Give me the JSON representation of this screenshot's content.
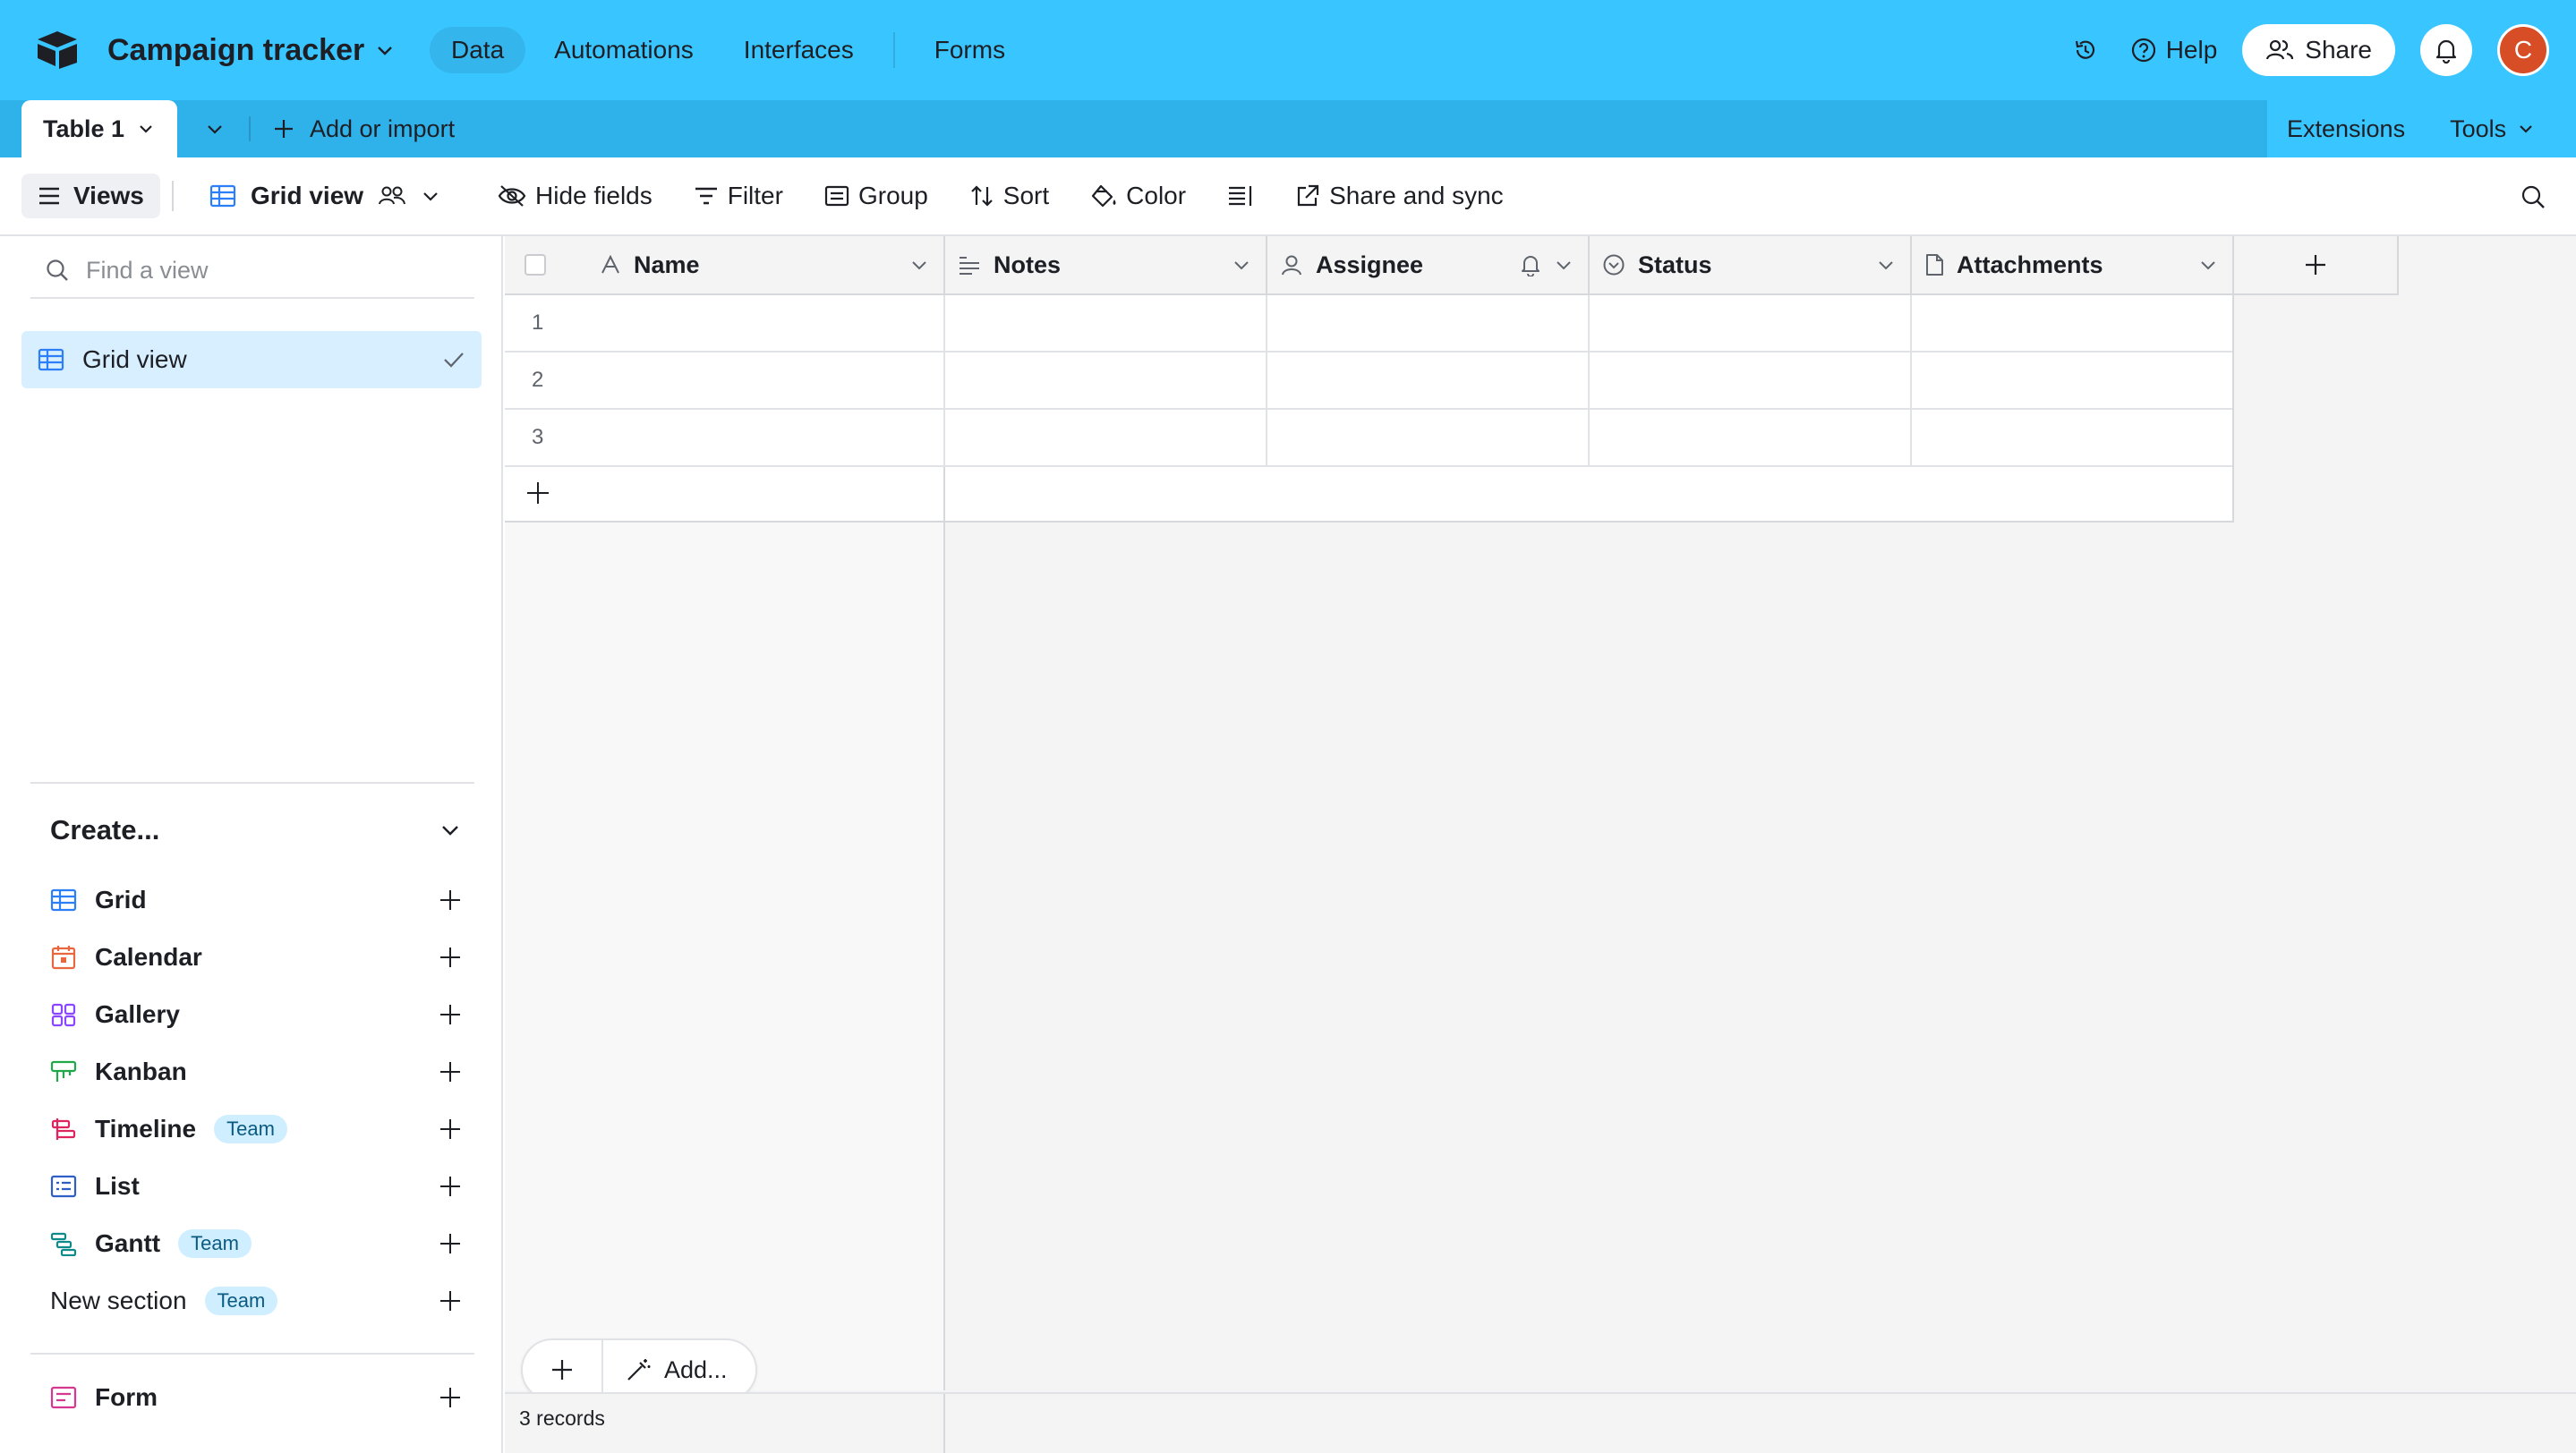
{
  "app": {
    "base_name": "Campaign tracker",
    "nav": [
      "Data",
      "Automations",
      "Interfaces",
      "Forms"
    ],
    "help_label": "Help",
    "share_label": "Share",
    "avatar_initial": "C"
  },
  "tabs": {
    "active_table": "Table 1",
    "add_import_label": "Add or import",
    "extensions_label": "Extensions",
    "tools_label": "Tools"
  },
  "toolbar": {
    "views_label": "Views",
    "view_name": "Grid view",
    "hide_fields": "Hide fields",
    "filter": "Filter",
    "group": "Group",
    "sort": "Sort",
    "color": "Color",
    "share_sync": "Share and sync"
  },
  "sidebar": {
    "find_placeholder": "Find a view",
    "current_view": "Grid view",
    "create_heading": "Create...",
    "create_items": [
      {
        "label": "Grid",
        "icon": "grid-icon",
        "color": "#2d7ff9"
      },
      {
        "label": "Calendar",
        "icon": "calendar-icon",
        "color": "#e8673e"
      },
      {
        "label": "Gallery",
        "icon": "gallery-icon",
        "color": "#8b46ff"
      },
      {
        "label": "Kanban",
        "icon": "kanban-icon",
        "color": "#20a84a"
      },
      {
        "label": "Timeline",
        "icon": "timeline-icon",
        "color": "#e0245e",
        "badge": "Team"
      },
      {
        "label": "List",
        "icon": "list-icon",
        "color": "#2d5fc6"
      },
      {
        "label": "Gantt",
        "icon": "gantt-icon",
        "color": "#0d8a8a",
        "badge": "Team"
      },
      {
        "label": "New section",
        "badge": "Team"
      }
    ],
    "form_item": {
      "label": "Form",
      "icon": "form-icon",
      "color": "#d6378f"
    }
  },
  "grid": {
    "columns": [
      "Name",
      "Notes",
      "Assignee",
      "Status",
      "Attachments"
    ],
    "row_numbers": [
      "1",
      "2",
      "3"
    ],
    "add_label": "Add...",
    "record_count": "3 records"
  },
  "colors": {
    "appbar": "#39c5ff",
    "tabbar": "#2fb1ea",
    "selected_view": "#d8efff",
    "team_badge": "#cfeeff",
    "avatar": "#d74d26"
  }
}
